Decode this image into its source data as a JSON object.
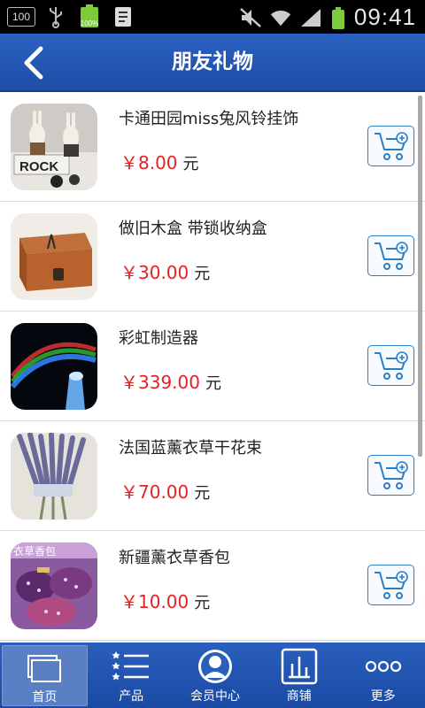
{
  "status_bar": {
    "battery_box_text": "100",
    "battery_level": "100%",
    "time": "09:41"
  },
  "header": {
    "title": "朋友礼物",
    "back_icon": "chevron-left-icon"
  },
  "products": [
    {
      "name": "卡通田园miss兔风铃挂饰",
      "price": "￥8.00",
      "unit": "元"
    },
    {
      "name": "做旧木盒 带锁收纳盒",
      "price": "￥30.00",
      "unit": "元"
    },
    {
      "name": "彩虹制造器",
      "price": "￥339.00",
      "unit": "元"
    },
    {
      "name": "法国蓝薰衣草干花束",
      "price": "￥70.00",
      "unit": "元"
    },
    {
      "name": "新疆薰衣草香包",
      "price": "￥10.00",
      "unit": "元"
    }
  ],
  "thumb_texts": {
    "rock": "ROCK",
    "sachet": "衣草香包"
  },
  "bottom_nav": [
    {
      "label": "首页",
      "icon": "home-windows-icon"
    },
    {
      "label": "产品",
      "icon": "star-list-icon"
    },
    {
      "label": "会员中心",
      "icon": "member-avatar-icon"
    },
    {
      "label": "商铺",
      "icon": "shop-chart-icon"
    },
    {
      "label": "更多",
      "icon": "more-dots-icon"
    }
  ],
  "colors": {
    "brand_blue": "#2b61c0",
    "price_red": "#e52222",
    "cart_blue": "#2a7ec8"
  }
}
